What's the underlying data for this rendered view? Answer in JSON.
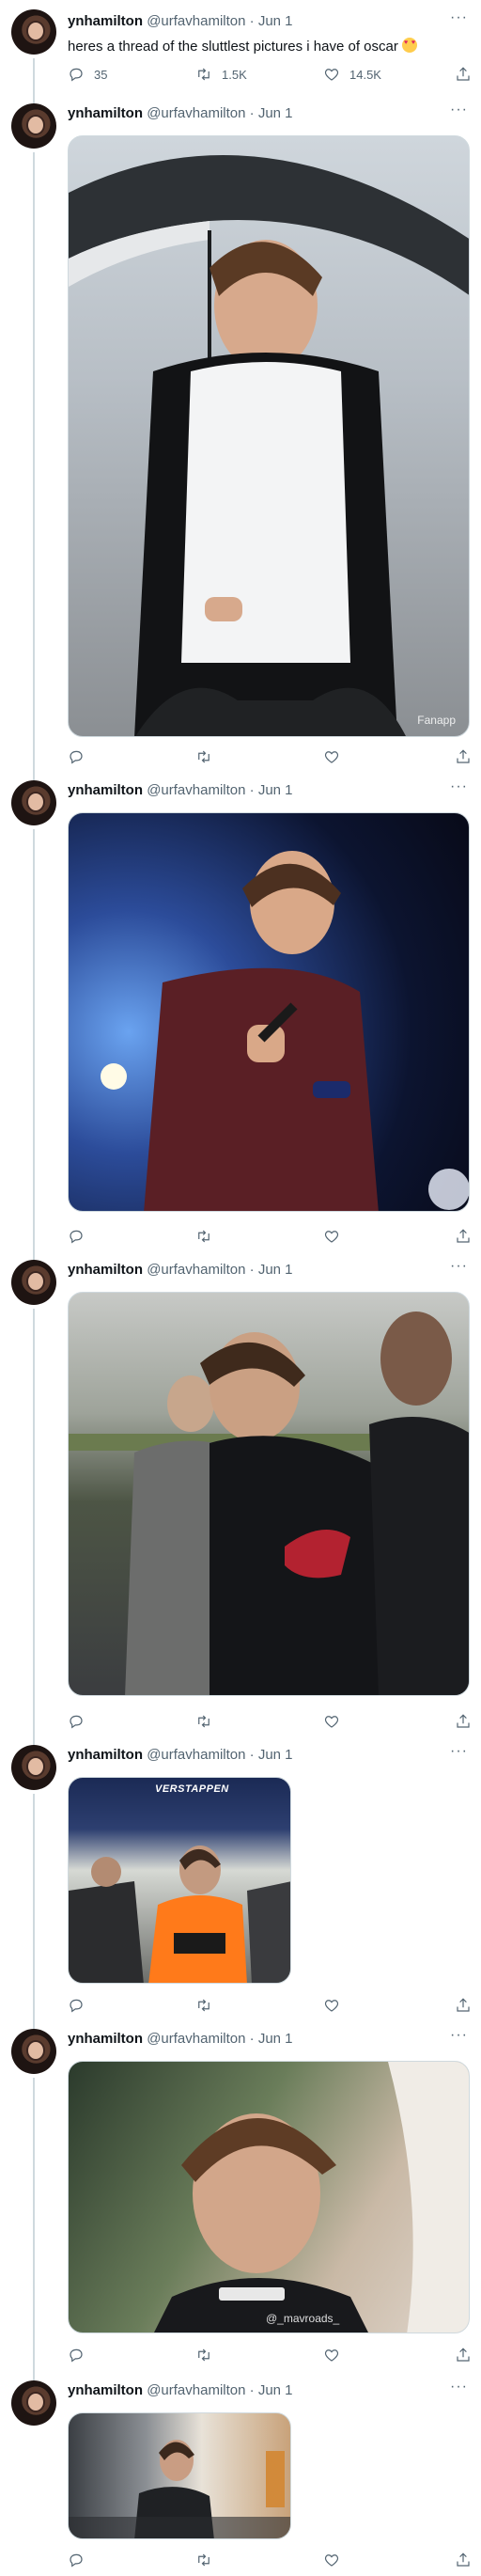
{
  "tweets": [
    {
      "name": "ynhamilton",
      "handle": "@urfavhamilton",
      "date": "Jun 1",
      "text": "heres a thread of the sluttlest pictures i have of oscar",
      "emoji_icon": "smiling-face-with-heart-eyes-icon",
      "counts": {
        "replies": "35",
        "retweets": "1.5K",
        "likes": "14.5K"
      }
    },
    {
      "name": "ynhamilton",
      "handle": "@urfavhamilton",
      "date": "Jun 1",
      "media_watermark": "Fanapp"
    },
    {
      "name": "ynhamilton",
      "handle": "@urfavhamilton",
      "date": "Jun 1"
    },
    {
      "name": "ynhamilton",
      "handle": "@urfavhamilton",
      "date": "Jun 1"
    },
    {
      "name": "ynhamilton",
      "handle": "@urfavhamilton",
      "date": "Jun 1",
      "media_caption": "VERSTAPPEN"
    },
    {
      "name": "ynhamilton",
      "handle": "@urfavhamilton",
      "date": "Jun 1",
      "media_watermark": "@_mavroads_"
    },
    {
      "name": "ynhamilton",
      "handle": "@urfavhamilton",
      "date": "Jun 1"
    }
  ],
  "dot": "·",
  "more": "···",
  "colors": {
    "text": "#0f1419",
    "secondary": "#536471",
    "line": "#cfd9de"
  }
}
